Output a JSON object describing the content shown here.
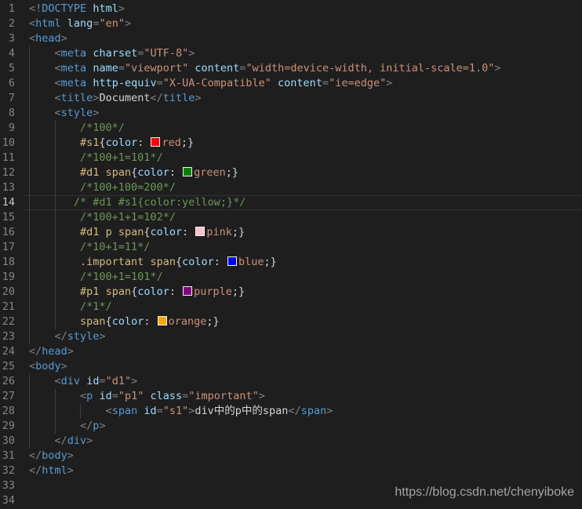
{
  "editor": {
    "background": "#1e1e1e",
    "current_line": 14,
    "palette": {
      "punct": "#808080",
      "tag": "#569cd6",
      "attr": "#9cdcfe",
      "string": "#ce9178",
      "text": "#d4d4d4",
      "plain": "#d4d4d4",
      "comment": "#6a9955",
      "selector": "#d7ba7d",
      "prop": "#9cdcfe",
      "value": "#ce9178",
      "line_number": "#858585",
      "active_line_number": "#c6c6c6",
      "indent_guide": "#404040",
      "current_line_border": "#343434"
    },
    "swatch_colors": {
      "red": "#ff0000",
      "green": "#008000",
      "pink": "#ffc0cb",
      "blue": "#0000ff",
      "purple": "#800080",
      "orange": "#ffa500"
    },
    "lines": [
      {
        "n": 1,
        "guides": [],
        "tokens": [
          [
            "punct",
            "<!"
          ],
          [
            "tag",
            "DOCTYPE"
          ],
          [
            "plain",
            " "
          ],
          [
            "attr",
            "html"
          ],
          [
            "punct",
            ">"
          ]
        ]
      },
      {
        "n": 2,
        "guides": [],
        "tokens": [
          [
            "punct",
            "<"
          ],
          [
            "tag",
            "html"
          ],
          [
            "plain",
            " "
          ],
          [
            "attr",
            "lang"
          ],
          [
            "punct",
            "="
          ],
          [
            "string",
            "\"en\""
          ],
          [
            "punct",
            ">"
          ]
        ]
      },
      {
        "n": 3,
        "guides": [],
        "tokens": [
          [
            "punct",
            "<"
          ],
          [
            "tag",
            "head"
          ],
          [
            "punct",
            ">"
          ]
        ]
      },
      {
        "n": 4,
        "guides": [
          0
        ],
        "tokens": [
          [
            "plain",
            "    "
          ],
          [
            "punct",
            "<"
          ],
          [
            "tag",
            "meta"
          ],
          [
            "plain",
            " "
          ],
          [
            "attr",
            "charset"
          ],
          [
            "punct",
            "="
          ],
          [
            "string",
            "\"UTF-8\""
          ],
          [
            "punct",
            ">"
          ]
        ]
      },
      {
        "n": 5,
        "guides": [
          0
        ],
        "tokens": [
          [
            "plain",
            "    "
          ],
          [
            "punct",
            "<"
          ],
          [
            "tag",
            "meta"
          ],
          [
            "plain",
            " "
          ],
          [
            "attr",
            "name"
          ],
          [
            "punct",
            "="
          ],
          [
            "string",
            "\"viewport\""
          ],
          [
            "plain",
            " "
          ],
          [
            "attr",
            "content"
          ],
          [
            "punct",
            "="
          ],
          [
            "string",
            "\"width=device-width, initial-scale=1.0\""
          ],
          [
            "punct",
            ">"
          ]
        ]
      },
      {
        "n": 6,
        "guides": [
          0
        ],
        "tokens": [
          [
            "plain",
            "    "
          ],
          [
            "punct",
            "<"
          ],
          [
            "tag",
            "meta"
          ],
          [
            "plain",
            " "
          ],
          [
            "attr",
            "http-equiv"
          ],
          [
            "punct",
            "="
          ],
          [
            "string",
            "\"X-UA-Compatible\""
          ],
          [
            "plain",
            " "
          ],
          [
            "attr",
            "content"
          ],
          [
            "punct",
            "="
          ],
          [
            "string",
            "\"ie=edge\""
          ],
          [
            "punct",
            ">"
          ]
        ]
      },
      {
        "n": 7,
        "guides": [
          0
        ],
        "tokens": [
          [
            "plain",
            "    "
          ],
          [
            "punct",
            "<"
          ],
          [
            "tag",
            "title"
          ],
          [
            "punct",
            ">"
          ],
          [
            "text",
            "Document"
          ],
          [
            "punct",
            "</"
          ],
          [
            "tag",
            "title"
          ],
          [
            "punct",
            ">"
          ]
        ]
      },
      {
        "n": 8,
        "guides": [
          0
        ],
        "tokens": [
          [
            "plain",
            "    "
          ],
          [
            "punct",
            "<"
          ],
          [
            "tag",
            "style"
          ],
          [
            "punct",
            ">"
          ]
        ]
      },
      {
        "n": 9,
        "guides": [
          0,
          4
        ],
        "tokens": [
          [
            "plain",
            "        "
          ],
          [
            "comment",
            "/*100*/"
          ]
        ]
      },
      {
        "n": 10,
        "guides": [
          0,
          4
        ],
        "tokens": [
          [
            "plain",
            "        "
          ],
          [
            "selector",
            "#s1"
          ],
          [
            "plain",
            "{"
          ],
          [
            "prop",
            "color"
          ],
          [
            "plain",
            ": "
          ],
          [
            "swatch",
            "#ff0000"
          ],
          [
            "value",
            "red"
          ],
          [
            "plain",
            ";}"
          ]
        ]
      },
      {
        "n": 11,
        "guides": [
          0,
          4
        ],
        "tokens": [
          [
            "plain",
            "        "
          ],
          [
            "comment",
            "/*100+1=101*/"
          ]
        ]
      },
      {
        "n": 12,
        "guides": [
          0,
          4
        ],
        "tokens": [
          [
            "plain",
            "        "
          ],
          [
            "selector",
            "#d1"
          ],
          [
            "plain",
            " "
          ],
          [
            "selector",
            "span"
          ],
          [
            "plain",
            "{"
          ],
          [
            "prop",
            "color"
          ],
          [
            "plain",
            ": "
          ],
          [
            "swatch",
            "#008000"
          ],
          [
            "value",
            "green"
          ],
          [
            "plain",
            ";}"
          ]
        ]
      },
      {
        "n": 13,
        "guides": [
          0,
          4
        ],
        "tokens": [
          [
            "plain",
            "        "
          ],
          [
            "comment",
            "/*100+100=200*/"
          ]
        ]
      },
      {
        "n": 14,
        "guides": [
          0,
          4
        ],
        "tokens": [
          [
            "plain",
            "       "
          ],
          [
            "comment",
            "/* #d1 #s1{color:yellow;}*/"
          ]
        ]
      },
      {
        "n": 15,
        "guides": [
          0,
          4
        ],
        "tokens": [
          [
            "plain",
            "        "
          ],
          [
            "comment",
            "/*100+1+1=102*/"
          ]
        ]
      },
      {
        "n": 16,
        "guides": [
          0,
          4
        ],
        "tokens": [
          [
            "plain",
            "        "
          ],
          [
            "selector",
            "#d1"
          ],
          [
            "plain",
            " "
          ],
          [
            "selector",
            "p"
          ],
          [
            "plain",
            " "
          ],
          [
            "selector",
            "span"
          ],
          [
            "plain",
            "{"
          ],
          [
            "prop",
            "color"
          ],
          [
            "plain",
            ": "
          ],
          [
            "swatch",
            "#ffc0cb"
          ],
          [
            "value",
            "pink"
          ],
          [
            "plain",
            ";}"
          ]
        ]
      },
      {
        "n": 17,
        "guides": [
          0,
          4
        ],
        "tokens": [
          [
            "plain",
            "        "
          ],
          [
            "comment",
            "/*10+1=11*/"
          ]
        ]
      },
      {
        "n": 18,
        "guides": [
          0,
          4
        ],
        "tokens": [
          [
            "plain",
            "        "
          ],
          [
            "selector",
            ".important"
          ],
          [
            "plain",
            " "
          ],
          [
            "selector",
            "span"
          ],
          [
            "plain",
            "{"
          ],
          [
            "prop",
            "color"
          ],
          [
            "plain",
            ": "
          ],
          [
            "swatch",
            "#0000ff"
          ],
          [
            "value",
            "blue"
          ],
          [
            "plain",
            ";}"
          ]
        ]
      },
      {
        "n": 19,
        "guides": [
          0,
          4
        ],
        "tokens": [
          [
            "plain",
            "        "
          ],
          [
            "comment",
            "/*100+1=101*/"
          ]
        ]
      },
      {
        "n": 20,
        "guides": [
          0,
          4
        ],
        "tokens": [
          [
            "plain",
            "        "
          ],
          [
            "selector",
            "#p1"
          ],
          [
            "plain",
            " "
          ],
          [
            "selector",
            "span"
          ],
          [
            "plain",
            "{"
          ],
          [
            "prop",
            "color"
          ],
          [
            "plain",
            ": "
          ],
          [
            "swatch",
            "#800080"
          ],
          [
            "value",
            "purple"
          ],
          [
            "plain",
            ";}"
          ]
        ]
      },
      {
        "n": 21,
        "guides": [
          0,
          4
        ],
        "tokens": [
          [
            "plain",
            "        "
          ],
          [
            "comment",
            "/*1*/"
          ]
        ]
      },
      {
        "n": 22,
        "guides": [
          0,
          4
        ],
        "tokens": [
          [
            "plain",
            "        "
          ],
          [
            "selector",
            "span"
          ],
          [
            "plain",
            "{"
          ],
          [
            "prop",
            "color"
          ],
          [
            "plain",
            ": "
          ],
          [
            "swatch",
            "#ffa500"
          ],
          [
            "value",
            "orange"
          ],
          [
            "plain",
            ";}"
          ]
        ]
      },
      {
        "n": 23,
        "guides": [
          0
        ],
        "tokens": [
          [
            "plain",
            "    "
          ],
          [
            "punct",
            "</"
          ],
          [
            "tag",
            "style"
          ],
          [
            "punct",
            ">"
          ]
        ]
      },
      {
        "n": 24,
        "guides": [],
        "tokens": [
          [
            "punct",
            "</"
          ],
          [
            "tag",
            "head"
          ],
          [
            "punct",
            ">"
          ]
        ]
      },
      {
        "n": 25,
        "guides": [],
        "tokens": [
          [
            "punct",
            "<"
          ],
          [
            "tag",
            "body"
          ],
          [
            "punct",
            ">"
          ]
        ]
      },
      {
        "n": 26,
        "guides": [
          0
        ],
        "tokens": [
          [
            "plain",
            "    "
          ],
          [
            "punct",
            "<"
          ],
          [
            "tag",
            "div"
          ],
          [
            "plain",
            " "
          ],
          [
            "attr",
            "id"
          ],
          [
            "punct",
            "="
          ],
          [
            "string",
            "\"d1\""
          ],
          [
            "punct",
            ">"
          ]
        ]
      },
      {
        "n": 27,
        "guides": [
          0,
          4
        ],
        "tokens": [
          [
            "plain",
            "        "
          ],
          [
            "punct",
            "<"
          ],
          [
            "tag",
            "p"
          ],
          [
            "plain",
            " "
          ],
          [
            "attr",
            "id"
          ],
          [
            "punct",
            "="
          ],
          [
            "string",
            "\"p1\""
          ],
          [
            "plain",
            " "
          ],
          [
            "attr",
            "class"
          ],
          [
            "punct",
            "="
          ],
          [
            "string",
            "\"important\""
          ],
          [
            "punct",
            ">"
          ]
        ]
      },
      {
        "n": 28,
        "guides": [
          0,
          4,
          8
        ],
        "tokens": [
          [
            "plain",
            "            "
          ],
          [
            "punct",
            "<"
          ],
          [
            "tag",
            "span"
          ],
          [
            "plain",
            " "
          ],
          [
            "attr",
            "id"
          ],
          [
            "punct",
            "="
          ],
          [
            "string",
            "\"s1\""
          ],
          [
            "punct",
            ">"
          ],
          [
            "text",
            "div中的p中的span"
          ],
          [
            "punct",
            "</"
          ],
          [
            "tag",
            "span"
          ],
          [
            "punct",
            ">"
          ]
        ]
      },
      {
        "n": 29,
        "guides": [
          0,
          4
        ],
        "tokens": [
          [
            "plain",
            "        "
          ],
          [
            "punct",
            "</"
          ],
          [
            "tag",
            "p"
          ],
          [
            "punct",
            ">"
          ]
        ]
      },
      {
        "n": 30,
        "guides": [
          0
        ],
        "tokens": [
          [
            "plain",
            "    "
          ],
          [
            "punct",
            "</"
          ],
          [
            "tag",
            "div"
          ],
          [
            "punct",
            ">"
          ]
        ]
      },
      {
        "n": 31,
        "guides": [],
        "tokens": [
          [
            "punct",
            "</"
          ],
          [
            "tag",
            "body"
          ],
          [
            "punct",
            ">"
          ]
        ]
      },
      {
        "n": 32,
        "guides": [],
        "tokens": [
          [
            "punct",
            "</"
          ],
          [
            "tag",
            "html"
          ],
          [
            "punct",
            ">"
          ]
        ]
      },
      {
        "n": 33,
        "guides": [],
        "tokens": []
      },
      {
        "n": 34,
        "guides": [],
        "tokens": []
      }
    ]
  },
  "watermark": {
    "text": "https://blog.csdn.net/chenyiboke",
    "color": "#a6a6a6"
  }
}
